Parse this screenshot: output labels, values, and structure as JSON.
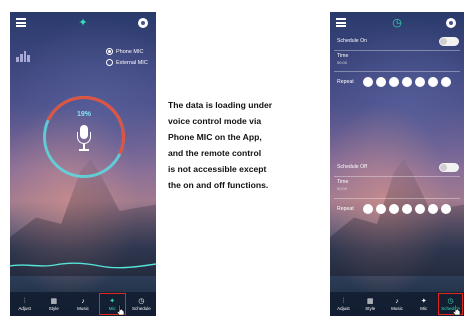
{
  "caption": {
    "lines": [
      "The data is loading under",
      "voice control mode via",
      "Phone MIC on the App,",
      "and the remote control",
      "is not accessible except",
      "the on and off functions."
    ]
  },
  "left_phone": {
    "radio_options": [
      {
        "label": "Phone MIC",
        "selected": true
      },
      {
        "label": "External MIC",
        "selected": false
      }
    ],
    "percent": "19%",
    "tabs": [
      {
        "label": "Adjust",
        "icon": "sliders-icon"
      },
      {
        "label": "Style",
        "icon": "grid-icon"
      },
      {
        "label": "Music",
        "icon": "music-note-icon"
      },
      {
        "label": "Mic",
        "icon": "mic-icon",
        "active": true
      },
      {
        "label": "Schedule",
        "icon": "clock-icon"
      }
    ],
    "accent_color": "#35e0b5",
    "highlight_color": "#e0261f"
  },
  "right_phone": {
    "schedule_on_label": "Schedule On",
    "time_label_1": "Time",
    "time_value_1": "00:00",
    "repeat_label_1": "Repeat",
    "schedule_off_label": "Schedule Off",
    "time_label_2": "Time",
    "time_value_2": "00:00",
    "repeat_label_2": "Repeat",
    "tabs": [
      {
        "label": "Adjust",
        "icon": "sliders-icon"
      },
      {
        "label": "Style",
        "icon": "grid-icon"
      },
      {
        "label": "Music",
        "icon": "music-note-icon"
      },
      {
        "label": "Mic",
        "icon": "mic-icon"
      },
      {
        "label": "Schedule",
        "icon": "clock-icon",
        "active": true
      }
    ]
  }
}
